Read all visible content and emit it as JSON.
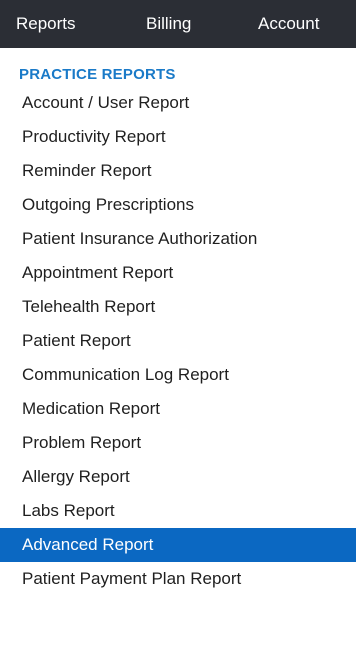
{
  "top_nav": {
    "items": [
      {
        "label": "Reports"
      },
      {
        "label": "Billing"
      },
      {
        "label": "Account"
      }
    ]
  },
  "practice_reports": {
    "header": "PRACTICE REPORTS",
    "items": [
      {
        "label": "Account / User Report"
      },
      {
        "label": "Productivity Report"
      },
      {
        "label": "Reminder Report"
      },
      {
        "label": "Outgoing Prescriptions"
      },
      {
        "label": "Patient Insurance Authorization"
      },
      {
        "label": "Appointment Report"
      },
      {
        "label": "Telehealth Report"
      },
      {
        "label": "Patient Report"
      },
      {
        "label": "Communication Log Report"
      },
      {
        "label": "Medication Report"
      },
      {
        "label": "Problem Report"
      },
      {
        "label": "Allergy Report"
      },
      {
        "label": "Labs Report"
      },
      {
        "label": "Advanced Report"
      },
      {
        "label": "Patient Payment Plan Report"
      }
    ],
    "selected_item": "Advanced Report"
  },
  "colors": {
    "nav_background": "#2b2e35",
    "section_header": "#1a7ac8",
    "selected_background": "#0b68c2"
  }
}
